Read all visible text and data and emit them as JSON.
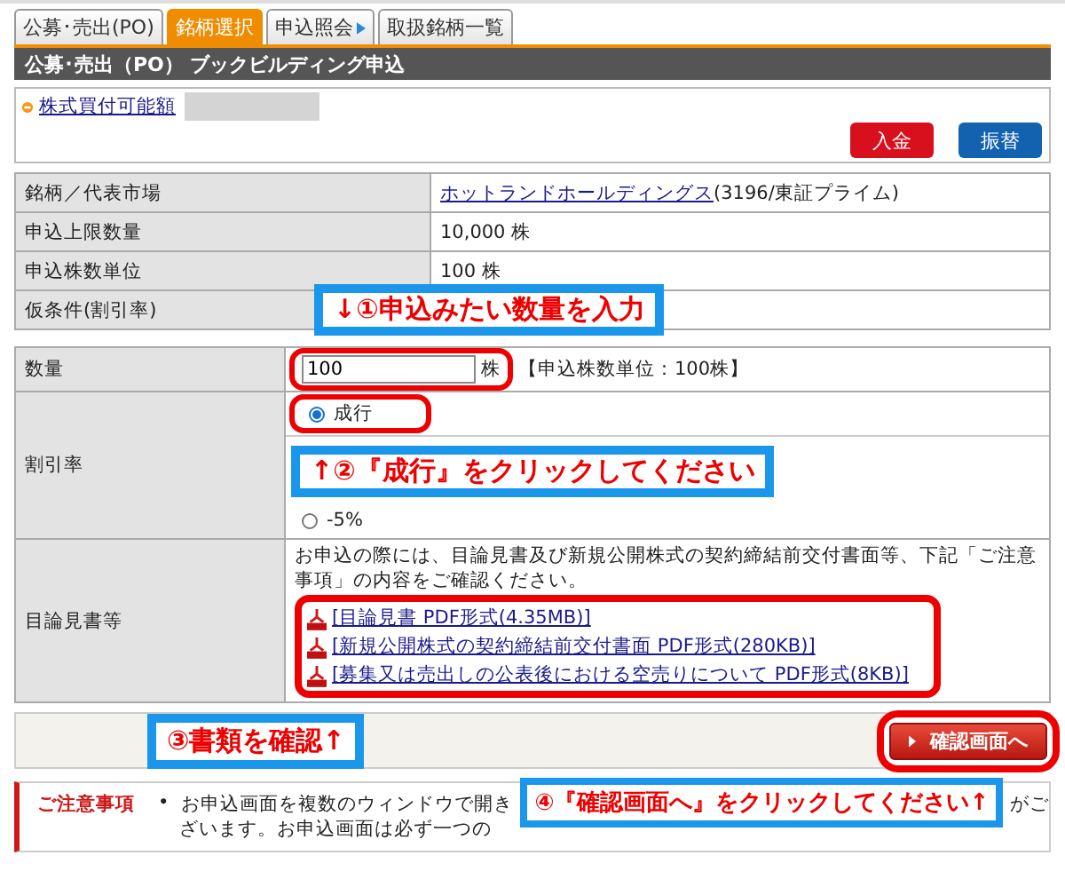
{
  "tabs": [
    {
      "label": "公募･売出(PO)",
      "selected": false,
      "arrow": false
    },
    {
      "label": "銘柄選択",
      "selected": true,
      "arrow": false
    },
    {
      "label": "申込照会",
      "selected": false,
      "arrow": true
    },
    {
      "label": "取扱銘柄一覧",
      "selected": false,
      "arrow": false
    }
  ],
  "header": "公募･売出（PO） ブックビルディング申込",
  "account": {
    "link": "株式買付可能額",
    "buttons": [
      {
        "label": "入金",
        "color": "#d8101e"
      },
      {
        "label": "振替",
        "color": "#1262b0"
      }
    ]
  },
  "info_rows": [
    {
      "label": "銘柄／代表市場",
      "link": "ホットランドホールディングス",
      "value": "(3196/東証プライム)"
    },
    {
      "label": "申込上限数量",
      "value": "10,000 株"
    },
    {
      "label": "申込株数単位",
      "value": "100 株"
    },
    {
      "label": "仮条件(割引率)"
    }
  ],
  "order": {
    "quantity": {
      "label": "数量",
      "value": "100",
      "unit": "株",
      "hint": "【申込株数単位：100株】"
    },
    "discount": {
      "label": "割引率",
      "options": [
        {
          "label": "成行",
          "selected": true
        },
        {
          "label": "-5%",
          "selected": false
        }
      ]
    },
    "documents": {
      "label": "目論見書等",
      "intro": "お申込の際には、目論見書及び新規公開株式の契約締結前交付書面等、下記「ご注意事項」の内容をご確認ください。",
      "links": [
        "[目論見書 PDF形式(4.35MB)]",
        "[新規公開株式の契約締結前交付書面 PDF形式(280KB)]",
        "[募集又は売出しの公表後における空売りについて PDF形式(8KB)]"
      ]
    }
  },
  "confirm_button": "確認画面へ",
  "notes": {
    "title": "ご注意事項",
    "bullet": "•",
    "line_start": "お申込画面を複数のウィンドウで開き",
    "line_end": "がご",
    "line_2": "ざいます。お申込画面は必ず一つの"
  },
  "annotations": [
    "↓①申込みたい数量を入力",
    "↑②『成行』をクリックしてください",
    "③書類を確認↑",
    "④『確認画面へ』をクリックしてください↑"
  ]
}
